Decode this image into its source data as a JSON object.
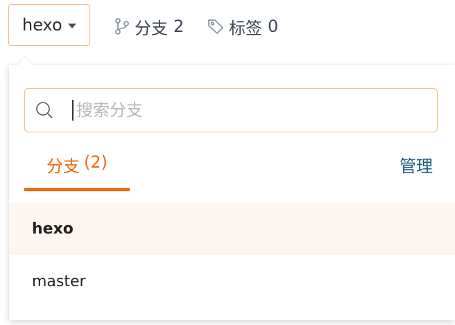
{
  "branch_selector": {
    "current": "hexo"
  },
  "meta": {
    "branches_label": "分支",
    "branches_count": "2",
    "tags_label": "标签",
    "tags_count": "0"
  },
  "dropdown": {
    "search_placeholder": "搜索分支",
    "tab_label": "分支",
    "tab_count": "(2)",
    "manage_label": "管理",
    "branches": [
      {
        "name": "hexo",
        "active": true
      },
      {
        "name": "master",
        "active": false
      }
    ]
  },
  "colors": {
    "accent": "#f06a0f",
    "border_focus": "#f5b97a",
    "link": "#1b5a7a",
    "active_row_bg": "#fdf5ef"
  },
  "icons": [
    "caret-down-icon",
    "branch-icon",
    "tag-icon",
    "search-icon"
  ]
}
